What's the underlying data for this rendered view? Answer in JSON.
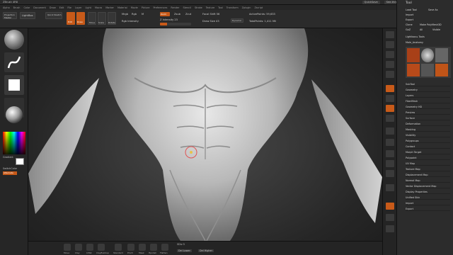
{
  "titlebar": {
    "app": "ZBrush 4R8",
    "quicksave": "QuickSave",
    "seethrough": "See-through 0",
    "menus": "Menus",
    "default_script": "DefaultZScript"
  },
  "menus": [
    "Alpha",
    "Brush",
    "Color",
    "Document",
    "Draw",
    "Edit",
    "File",
    "Layer",
    "Light",
    "Macro",
    "Marker",
    "Material",
    "Movie",
    "Picture",
    "Preferences",
    "Render",
    "Stencil",
    "Stroke",
    "Texture",
    "Tool",
    "Transform",
    "Zplugin",
    "Zscript"
  ],
  "toolbar": {
    "projection_master": "Projection Master",
    "lightbox": "LightBox",
    "quick_sketch": "Quick Sketch",
    "edit": "Edit",
    "draw": "Draw",
    "move": "Move",
    "scale": "Scale",
    "rotate": "Rotate",
    "mrgb": "Mrgb",
    "rgb": "Rgb",
    "m": "M",
    "zadd": "Zadd",
    "zsub": "Zsub",
    "zcut": "Zcut",
    "rgb_intensity": "Rgb Intensity",
    "z_intensity": "Z Intensity 23",
    "z_intensity_value": 23,
    "focal_shift": "Focal Shift 56",
    "draw_size": "Draw Size 43",
    "dynamic": "Dynamic",
    "active_points": "ActivePoints: 59,633",
    "total_points": "TotalPoints: 1,411 Mil"
  },
  "leftpanel": {
    "gradient": "Gradient",
    "switch_color": "SwitchColor",
    "alternate": "Alternate",
    "main_color": "#ffffff",
    "secondary_color": "#ffffff"
  },
  "tray": {
    "title": "Tool",
    "load_tool": "Load Tool",
    "save_as": "Save As",
    "import": "Import",
    "export": "Export",
    "clone": "Clone",
    "make_polymesh": "Make PolyMesh3D",
    "goz": "GoZ",
    "all": "All",
    "visible": "Visible",
    "lightbox_tools": "Lightbox ▸ Tools",
    "current_tool": "Male_Anatomy",
    "sections": [
      "SubTool",
      "Geometry",
      "Layers",
      "FiberMesh",
      "Geometry HD",
      "Preview",
      "Surface",
      "Deformation",
      "Masking",
      "Visibility",
      "Polygroups",
      "Contact",
      "Morph Target",
      "Polypaint",
      "UV Map",
      "Texture Map",
      "Displacement Map",
      "Normal Map",
      "Vector Displacement Map",
      "Display Properties",
      "Unified Skin",
      "Import",
      "Export"
    ]
  },
  "bottombar": {
    "buttons": [
      "Move",
      "Clay",
      "Inflat",
      "ClayBuildup",
      "Standard",
      "Pinch",
      "Mask",
      "Hpolish",
      "Flatten"
    ],
    "sdiv": "SDiv 5",
    "del_lower": "Del Lower",
    "del_higher": "Del Higher"
  },
  "accent": "#c85a19"
}
